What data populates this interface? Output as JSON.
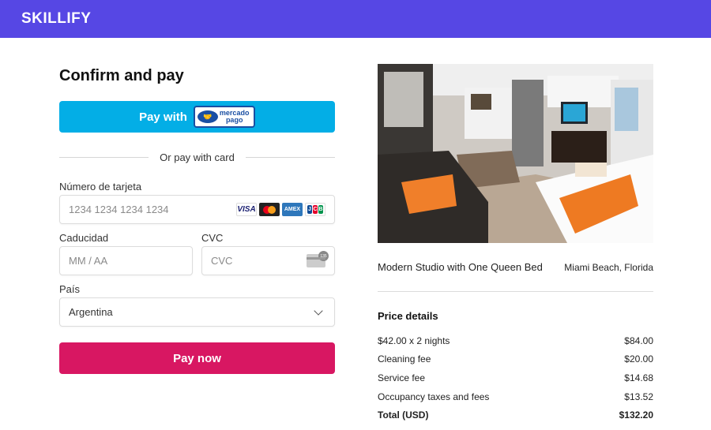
{
  "header": {
    "brand": "SKILLIFY",
    "color": "#5647e4"
  },
  "checkout": {
    "title": "Confirm and pay",
    "mercadopago": {
      "label": "Pay with",
      "logo_text_top": "mercado",
      "logo_text_bottom": "pago",
      "icon": "handshake-icon"
    },
    "divider_text": "Or pay with card",
    "card_number": {
      "label": "Número de tarjeta",
      "placeholder": "1234 1234 1234 1234",
      "brands": [
        "VISA",
        "Mastercard",
        "AMEX",
        "JCB"
      ]
    },
    "expiry": {
      "label": "Caducidad",
      "placeholder": "MM / AA"
    },
    "cvc": {
      "label": "CVC",
      "placeholder": "CVC",
      "icon": "cvc-card-icon",
      "badge": "135"
    },
    "country": {
      "label": "País",
      "value": "Argentina"
    },
    "pay_button": "Pay now",
    "pay_button_color": "#d81762"
  },
  "listing": {
    "name": "Modern Studio with One Queen Bed",
    "location": "Miami Beach, Florida",
    "photo": "hotel-room-photo"
  },
  "price_details": {
    "title": "Price details",
    "rows": [
      {
        "label": "$42.00 x 2 nights",
        "amount": "$84.00"
      },
      {
        "label": "Cleaning fee",
        "amount": "$20.00"
      },
      {
        "label": "Service fee",
        "amount": "$14.68"
      },
      {
        "label": "Occupancy taxes and fees",
        "amount": "$13.52"
      }
    ],
    "total": {
      "label": "Total (USD)",
      "amount": "$132.20"
    }
  }
}
